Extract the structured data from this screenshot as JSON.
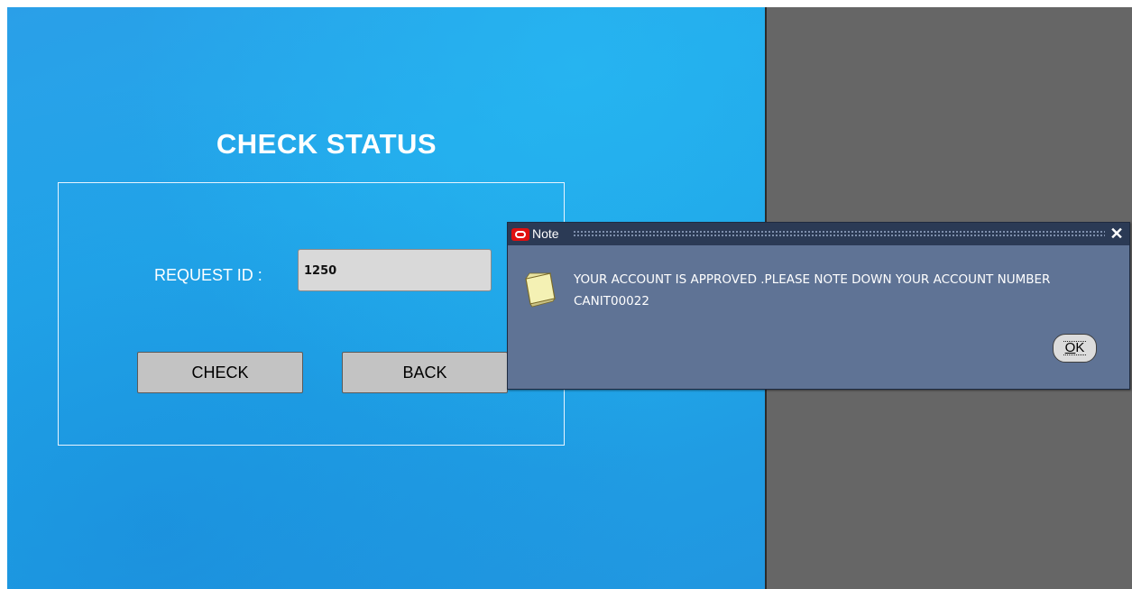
{
  "form": {
    "title": "CHECK STATUS",
    "request_id_label": "REQUEST ID :",
    "request_id_value": "1250",
    "check_label": "CHECK",
    "back_label": "BACK"
  },
  "dialog": {
    "title": "Note",
    "close_glyph": "✕",
    "message": "YOUR ACCOUNT IS APPROVED .PLEASE NOTE DOWN YOUR ACCOUNT NUMBER CANIT00022",
    "ok_mnemonic": "O",
    "ok_rest": "K"
  },
  "colors": {
    "form_background": "#22a8ea",
    "right_pane": "#666666",
    "dialog_background": "#5f7395",
    "titlebar": "#2b3a55",
    "button_face": "#c3c3c3"
  },
  "icons": {
    "dialog_title_icon": "oracle-icon",
    "dialog_body_icon": "note-icon",
    "close": "close-icon"
  }
}
